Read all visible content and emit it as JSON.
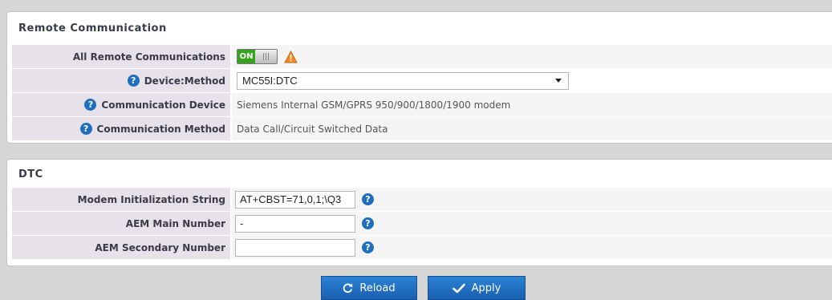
{
  "remote": {
    "title": "Remote Communication",
    "all_label": "All Remote Communications",
    "toggle_text": "ON",
    "device_method_label": "Device:Method",
    "device_method_value": "MC55I:DTC",
    "comm_device_label": "Communication Device",
    "comm_device_value": "Siemens Internal GSM/GPRS 950/900/1800/1900 modem",
    "comm_method_label": "Communication Method",
    "comm_method_value": "Data Call/Circuit Switched Data"
  },
  "dtc": {
    "title": "DTC",
    "init_label": "Modem Initialization String",
    "init_value": "AT+CBST=71,0,1;\\Q3",
    "main_label": "AEM Main Number",
    "main_value": "-",
    "secondary_label": "AEM Secondary Number",
    "secondary_value": ""
  },
  "help_glyph": "?",
  "buttons": {
    "reload": "Reload",
    "apply": "Apply"
  },
  "colors": {
    "accent": "#1f6fbf",
    "toggle_on": "#36a21e",
    "warning": "#f08a24"
  }
}
